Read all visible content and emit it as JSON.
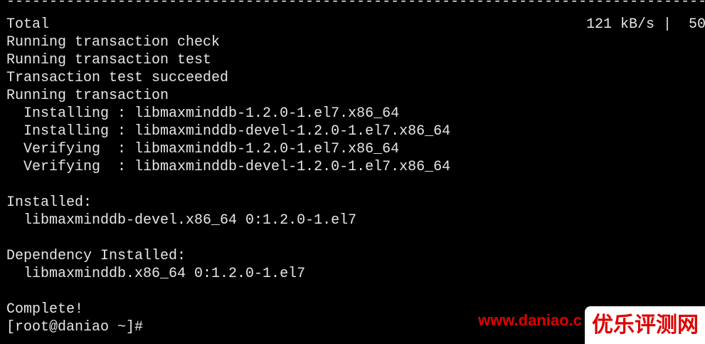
{
  "terminal": {
    "separator": "-------------------------------------------------------------------------------------------------",
    "total_label": "Total",
    "total_rate": "121 kB/s |  50",
    "lines": [
      "Running transaction check",
      "Running transaction test",
      "Transaction test succeeded",
      "Running transaction",
      "  Installing : libmaxminddb-1.2.0-1.el7.x86_64",
      "  Installing : libmaxminddb-devel-1.2.0-1.el7.x86_64",
      "  Verifying  : libmaxminddb-1.2.0-1.el7.x86_64",
      "  Verifying  : libmaxminddb-devel-1.2.0-1.el7.x86_64",
      "",
      "Installed:",
      "  libmaxminddb-devel.x86_64 0:1.2.0-1.el7",
      "",
      "Dependency Installed:",
      "  libmaxminddb.x86_64 0:1.2.0-1.el7",
      "",
      "Complete!",
      "[root@daniao ~]#"
    ]
  },
  "watermark": {
    "url": "www.daniao.c",
    "badge": "优乐评测网",
    "color": "#e00000"
  },
  "colors": {
    "background": "#000000",
    "foreground": "#e6e6e6"
  }
}
